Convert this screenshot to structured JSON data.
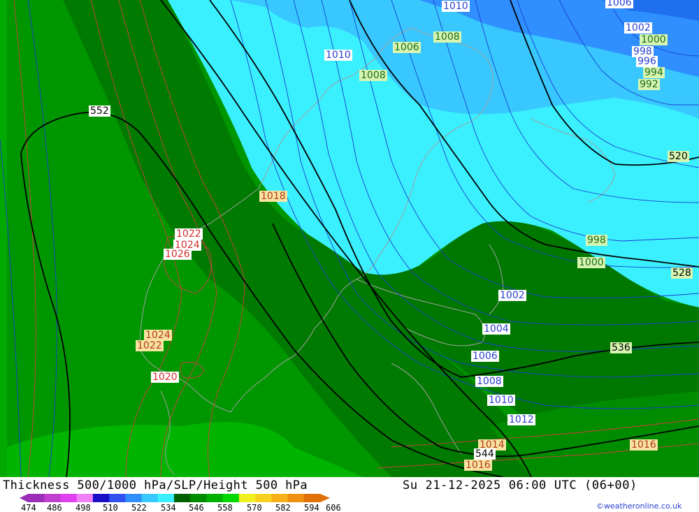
{
  "title": "Thickness 500/1000 hPa/SLP/Height 500 hPa",
  "datetime": "Su 21-12-2025 06:00 UTC (06+00)",
  "credit": "©weatheronline.co.uk",
  "scale": {
    "ticks": [
      "474",
      "486",
      "498",
      "510",
      "522",
      "534",
      "546",
      "558",
      "570",
      "582",
      "594",
      "606"
    ],
    "colors": [
      "#9b2fb8",
      "#c03fcf",
      "#e040f0",
      "#f080f8",
      "#1a10c8",
      "#3050f0",
      "#2f8fff",
      "#38c8ff",
      "#3af0ff",
      "#006000",
      "#008c00",
      "#00b000",
      "#00d800",
      "#f0f020",
      "#f8d020",
      "#f8b018",
      "#f09010",
      "#e07008"
    ]
  },
  "colors": {
    "thickness_dark_green": "#007a00",
    "thickness_mid_green": "#009600",
    "thickness_light_green": "#00b800",
    "thickness_cyan": "#3af0ff",
    "thickness_light_blue": "#38c8ff",
    "thickness_blue": "#2f8fff",
    "isobar_blue": "#1a3fd0",
    "isobar_red": "#d04040",
    "height_line": "#000000",
    "coastline": "#a0a0a0"
  },
  "labels": {
    "slp_blue": [
      {
        "text": "1010"
      },
      {
        "text": "1006"
      },
      {
        "text": "1002"
      },
      {
        "text": "1010"
      },
      {
        "text": "1002"
      },
      {
        "text": "1004"
      },
      {
        "text": "1006"
      },
      {
        "text": "1008"
      },
      {
        "text": "1010"
      },
      {
        "text": "1012"
      },
      {
        "text": "998"
      },
      {
        "text": "996"
      }
    ],
    "slp_green": [
      {
        "text": "1008"
      },
      {
        "text": "1006"
      },
      {
        "text": "1008"
      },
      {
        "text": "1000"
      },
      {
        "text": "998"
      },
      {
        "text": "994"
      },
      {
        "text": "992"
      },
      {
        "text": "998"
      },
      {
        "text": "1000"
      }
    ],
    "slp_red": [
      {
        "text": "1020"
      },
      {
        "text": "1022"
      },
      {
        "text": "1024"
      },
      {
        "text": "1026"
      }
    ],
    "slp_orange": [
      {
        "text": "1018"
      },
      {
        "text": "1024"
      },
      {
        "text": "1022"
      },
      {
        "text": "1014"
      },
      {
        "text": "1016"
      },
      {
        "text": "1016"
      }
    ],
    "height": [
      {
        "text": "552"
      },
      {
        "text": "520"
      },
      {
        "text": "528"
      },
      {
        "text": "536"
      },
      {
        "text": "544"
      }
    ]
  }
}
